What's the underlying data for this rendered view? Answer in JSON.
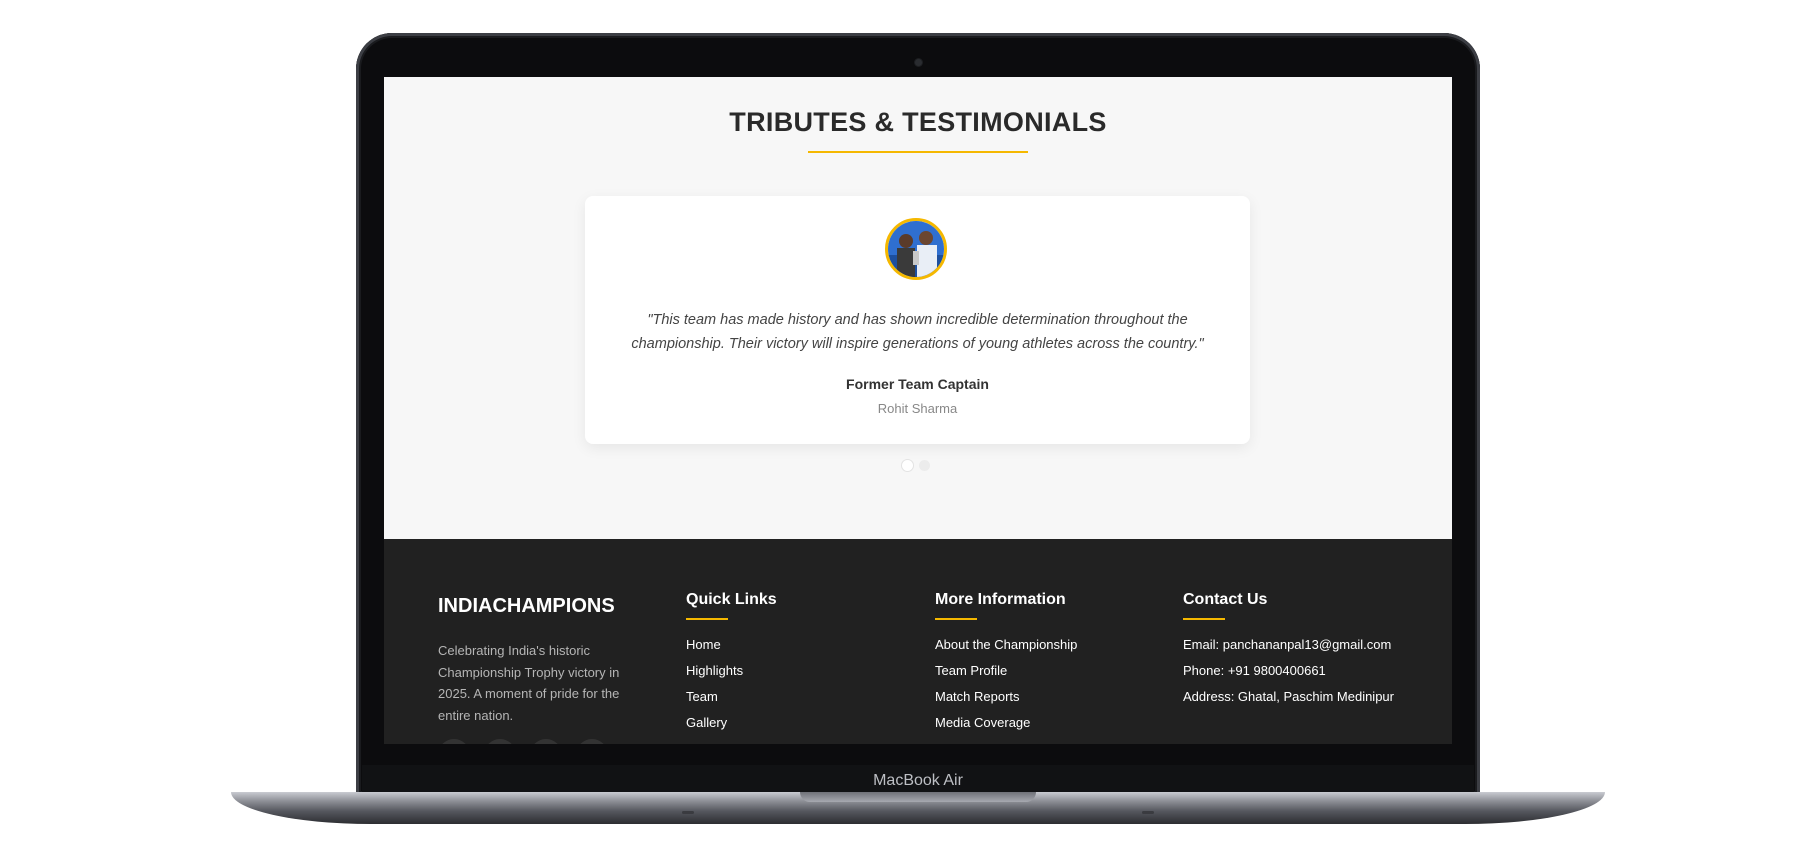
{
  "device": {
    "label": "MacBook Air"
  },
  "testimonials": {
    "title": "TRIBUTES & TESTIMONIALS",
    "active": {
      "quote": "\"This team has made history and has shown incredible determination throughout the championship. Their victory will inspire generations of young athletes across the country.\"",
      "role": "Former Team Captain",
      "name": "Rohit Sharma"
    },
    "dots_count": 2,
    "active_dot": 1
  },
  "footer": {
    "brand": "INDIACHAMPIONS",
    "about": "Celebrating India's historic Championship Trophy victory in 2025. A moment of pride for the entire nation.",
    "quick_links": {
      "title": "Quick Links",
      "items": [
        "Home",
        "Highlights",
        "Team",
        "Gallery"
      ]
    },
    "more_info": {
      "title": "More Information",
      "items": [
        "About the Championship",
        "Team Profile",
        "Match Reports",
        "Media Coverage"
      ]
    },
    "contact": {
      "title": "Contact Us",
      "email": "Email: panchananpal13@gmail.com",
      "phone": "Phone: +91 9800400661",
      "address": "Address: Ghatal, Paschim Medinipur"
    }
  },
  "colors": {
    "accent": "#f5b800",
    "footer_bg": "#212121",
    "section_bg": "#f7f7f7"
  }
}
